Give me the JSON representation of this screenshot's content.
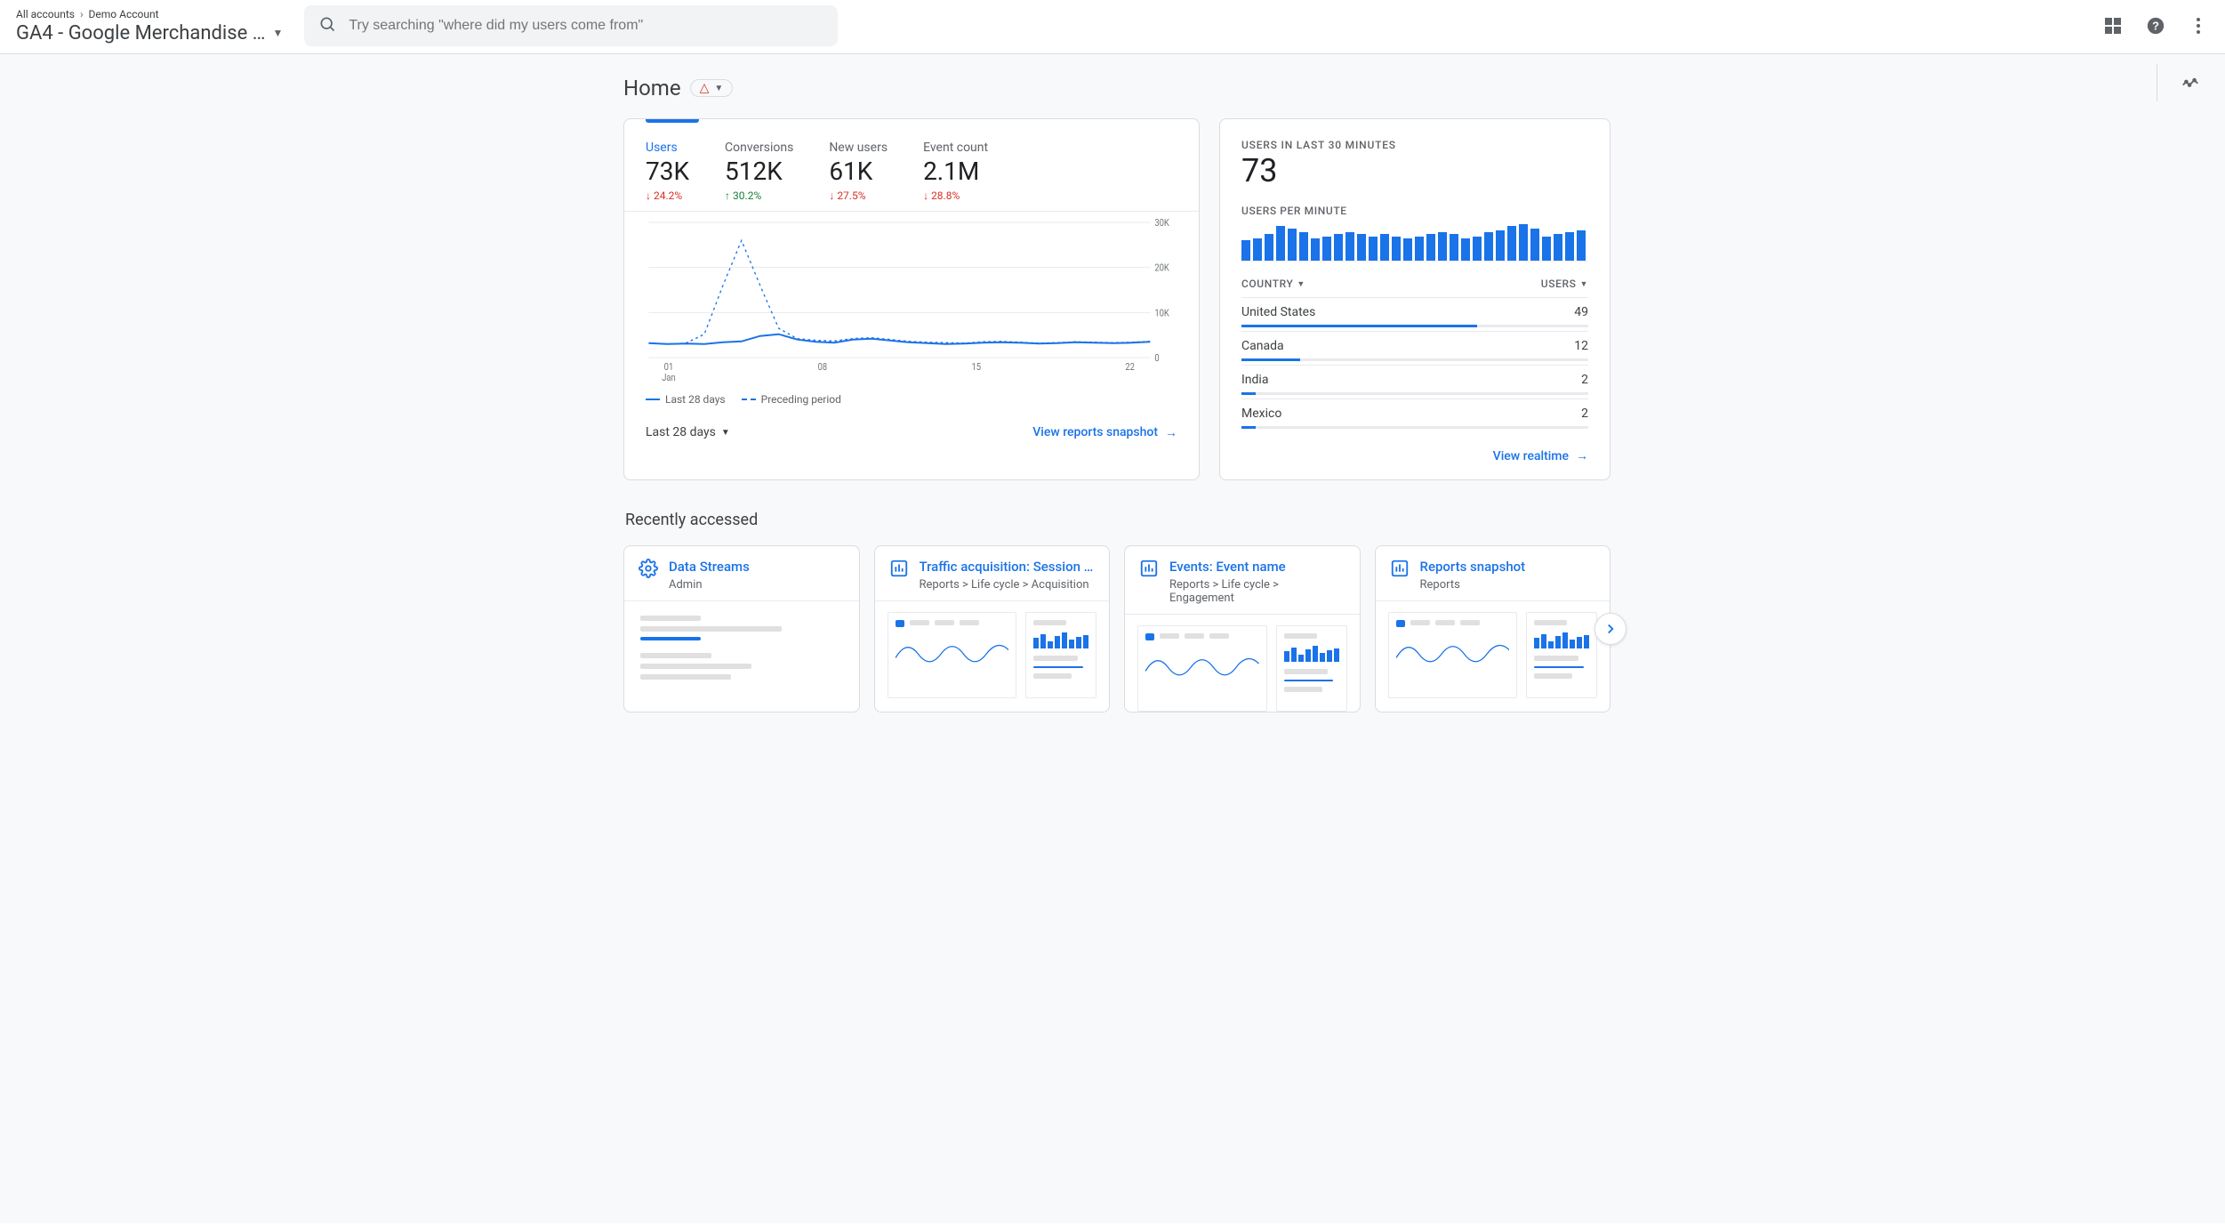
{
  "header": {
    "breadcrumb": {
      "root": "All accounts",
      "current": "Demo Account"
    },
    "property_title": "GA4 - Google Merchandise …",
    "search_placeholder": "Try searching \"where did my users come from\""
  },
  "page": {
    "title": "Home",
    "range_label": "Last 28 days",
    "snapshot_link": "View reports snapshot",
    "realtime_link": "View realtime"
  },
  "metrics": [
    {
      "label": "Users",
      "value": "73K",
      "delta": "24.2%",
      "dir": "down",
      "active": true
    },
    {
      "label": "Conversions",
      "value": "512K",
      "delta": "30.2%",
      "dir": "up",
      "active": false
    },
    {
      "label": "New users",
      "value": "61K",
      "delta": "27.5%",
      "dir": "down",
      "active": false
    },
    {
      "label": "Event count",
      "value": "2.1M",
      "delta": "28.8%",
      "dir": "down",
      "active": false
    }
  ],
  "chart_data": {
    "type": "line",
    "title": "",
    "xlabel": "",
    "ylabel": "",
    "ylim": [
      0,
      30000
    ],
    "y_ticks": [
      "0",
      "10K",
      "20K",
      "30K"
    ],
    "x_ticks": [
      {
        "top": "01",
        "sub": "Jan"
      },
      {
        "top": "08",
        "sub": ""
      },
      {
        "top": "15",
        "sub": ""
      },
      {
        "top": "22",
        "sub": ""
      }
    ],
    "legend": {
      "current": "Last 28 days",
      "previous": "Preceding period"
    },
    "series": [
      {
        "name": "Last 28 days",
        "values": [
          3200,
          3000,
          3100,
          3000,
          3400,
          3600,
          4800,
          5200,
          4000,
          3500,
          3300,
          4000,
          4200,
          3800,
          3400,
          3200,
          3000,
          3100,
          3300,
          3400,
          3300,
          3100,
          3200,
          3400,
          3300,
          3200,
          3300,
          3500
        ]
      },
      {
        "name": "Preceding period",
        "values": [
          3200,
          3000,
          3200,
          5200,
          16000,
          26000,
          16000,
          6500,
          4200,
          3800,
          3700,
          4200,
          4400,
          4000,
          3600,
          3400,
          3300,
          3200,
          3500,
          3600,
          3400,
          3200,
          3300,
          3500,
          3400,
          3300,
          3400,
          3600
        ]
      }
    ]
  },
  "realtime": {
    "label": "USERS IN LAST 30 MINUTES",
    "value": "73",
    "sub_label": "USERS PER MINUTE",
    "table_head": {
      "dim": "COUNTRY",
      "metric": "USERS"
    },
    "bars": [
      20,
      22,
      26,
      34,
      32,
      28,
      22,
      24,
      26,
      28,
      26,
      24,
      26,
      24,
      22,
      24,
      26,
      28,
      26,
      22,
      24,
      28,
      30,
      34,
      36,
      32,
      24,
      26,
      28,
      30
    ],
    "rows": [
      {
        "label": "United States",
        "value": "49",
        "pct": 68
      },
      {
        "label": "Canada",
        "value": "12",
        "pct": 17
      },
      {
        "label": "India",
        "value": "2",
        "pct": 4
      },
      {
        "label": "Mexico",
        "value": "2",
        "pct": 4
      }
    ]
  },
  "recent": {
    "title": "Recently accessed",
    "items": [
      {
        "icon": "gear",
        "title": "Data Streams",
        "sub": "Admin"
      },
      {
        "icon": "bars",
        "title": "Traffic acquisition: Session defa…",
        "sub": "Reports > Life cycle > Acquisition"
      },
      {
        "icon": "bars",
        "title": "Events: Event name",
        "sub": "Reports > Life cycle > Engagement"
      },
      {
        "icon": "bars",
        "title": "Reports snapshot",
        "sub": "Reports"
      }
    ]
  }
}
